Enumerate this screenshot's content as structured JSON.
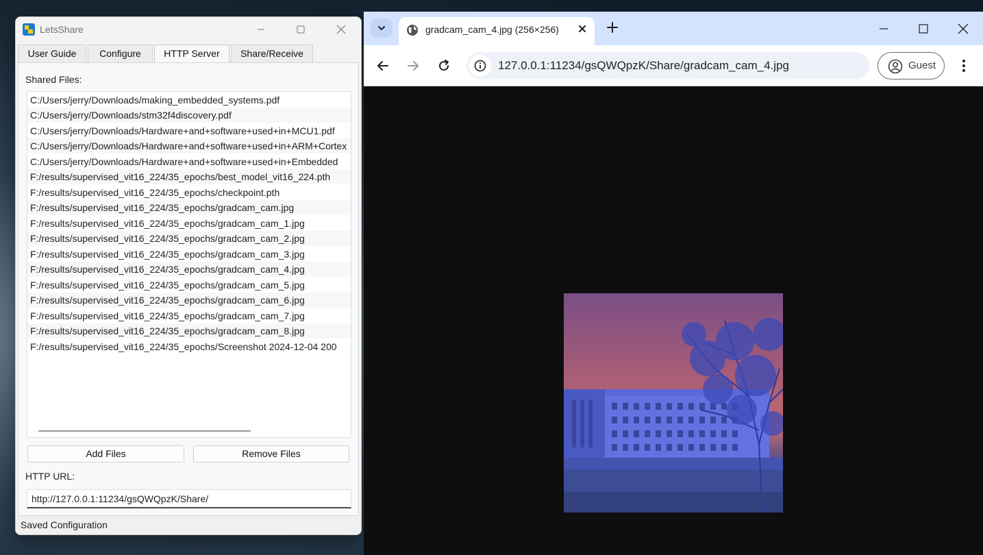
{
  "app": {
    "title": "LetsShare",
    "tabs": [
      {
        "label": "User Guide"
      },
      {
        "label": "Configure"
      },
      {
        "label": "HTTP Server"
      },
      {
        "label": "Share/Receive"
      }
    ],
    "active_tab": "HTTP Server",
    "shared_files_label": "Shared Files:",
    "files": [
      "C:/Users/jerry/Downloads/making_embedded_systems.pdf",
      "C:/Users/jerry/Downloads/stm32f4discovery.pdf",
      "C:/Users/jerry/Downloads/Hardware+and+software+used+in+MCU1.pdf",
      "C:/Users/jerry/Downloads/Hardware+and+software+used+in+ARM+Cortex",
      "C:/Users/jerry/Downloads/Hardware+and+software+used+in+Embedded",
      "F:/results/supervised_vit16_224/35_epochs/best_model_vit16_224.pth",
      "F:/results/supervised_vit16_224/35_epochs/checkpoint.pth",
      "F:/results/supervised_vit16_224/35_epochs/gradcam_cam.jpg",
      "F:/results/supervised_vit16_224/35_epochs/gradcam_cam_1.jpg",
      "F:/results/supervised_vit16_224/35_epochs/gradcam_cam_2.jpg",
      "F:/results/supervised_vit16_224/35_epochs/gradcam_cam_3.jpg",
      "F:/results/supervised_vit16_224/35_epochs/gradcam_cam_4.jpg",
      "F:/results/supervised_vit16_224/35_epochs/gradcam_cam_5.jpg",
      "F:/results/supervised_vit16_224/35_epochs/gradcam_cam_6.jpg",
      "F:/results/supervised_vit16_224/35_epochs/gradcam_cam_7.jpg",
      "F:/results/supervised_vit16_224/35_epochs/gradcam_cam_8.jpg",
      "F:/results/supervised_vit16_224/35_epochs/Screenshot 2024-12-04 200"
    ],
    "add_files_label": "Add Files",
    "remove_files_label": "Remove Files",
    "http_url_label": "HTTP URL:",
    "http_url_value": "http://127.0.0.1:11234/gsQWQpzK/Share/",
    "status": "Saved Configuration"
  },
  "browser": {
    "tab_title": "gradcam_cam_4.jpg (256×256)",
    "url": "127.0.0.1:11234/gsQWQpzK/Share/gradcam_cam_4.jpg",
    "profile_label": "Guest",
    "tab_bar_color": "#d3e3fd",
    "viewer_background": "#0e0e0e"
  },
  "icons": {
    "app_logo": "app-logo-icon",
    "minimize": "minimize-icon",
    "maximize": "maximize-icon",
    "close": "close-icon",
    "tab_search": "chevron-down-icon",
    "site": "globe-icon",
    "new_tab": "plus-icon",
    "back": "arrow-left-icon",
    "forward": "arrow-right-icon",
    "reload": "reload-icon",
    "site_info": "info-icon",
    "profile": "profile-icon",
    "menu": "kebab-menu-icon"
  }
}
